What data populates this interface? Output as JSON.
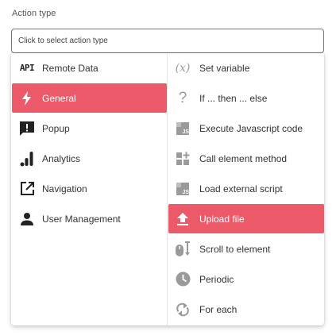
{
  "field": {
    "label": "Action type",
    "placeholder": "Click to select action type"
  },
  "categories": [
    {
      "label": "Remote Data",
      "icon": "api-icon",
      "active": false
    },
    {
      "label": "General",
      "icon": "lightning-icon",
      "active": true
    },
    {
      "label": "Popup",
      "icon": "popup-alert-icon",
      "active": false
    },
    {
      "label": "Analytics",
      "icon": "analytics-bars-icon",
      "active": false
    },
    {
      "label": "Navigation",
      "icon": "open-in-new-icon",
      "active": false
    },
    {
      "label": "User Management",
      "icon": "person-icon",
      "active": false
    }
  ],
  "actions": [
    {
      "label": "Set variable",
      "icon": "variable-fx-icon",
      "active": false
    },
    {
      "label": "If ... then ... else",
      "icon": "question-mark-icon",
      "active": false
    },
    {
      "label": "Execute Javascript code",
      "icon": "javascript-file-icon",
      "active": false
    },
    {
      "label": "Call element method",
      "icon": "element-method-icon",
      "active": false
    },
    {
      "label": "Load external script",
      "icon": "javascript-file-icon",
      "active": false
    },
    {
      "label": "Upload file",
      "icon": "upload-icon",
      "active": true
    },
    {
      "label": "Scroll to element",
      "icon": "scroll-mouse-icon",
      "active": false
    },
    {
      "label": "Periodic",
      "icon": "clock-icon",
      "active": false
    },
    {
      "label": "For each",
      "icon": "loop-arrows-icon",
      "active": false
    }
  ],
  "icon_text": {
    "api": "API",
    "fx": "(x)",
    "question": "?",
    "js": "JS"
  },
  "colors": {
    "accent": "#ec5a6a",
    "icon_gray": "#9a9a9a",
    "icon_dark": "#222222"
  }
}
